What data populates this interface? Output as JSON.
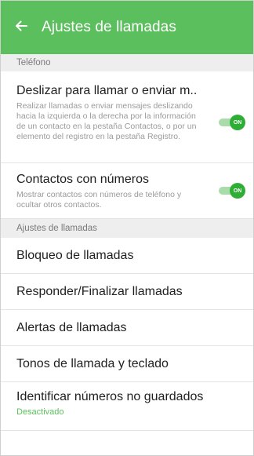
{
  "appbar": {
    "back_icon": "arrow-left-icon",
    "title": "Ajustes de llamadas",
    "color": "#5bbf5e"
  },
  "sections": {
    "phone_header": "Teléfono",
    "call_settings_header": "Ajustes de llamadas"
  },
  "swipe": {
    "title": "Deslizar para llamar o enviar m..",
    "description": "Realizar llamadas o enviar mensajes deslizando hacia la izquierda o la derecha por la información de un contacto en la pestaña Contactos, o por un elemento del registro en la pestaña Registro.",
    "toggle_label": "ON",
    "enabled": true
  },
  "contacts_numbers": {
    "title": "Contactos con números",
    "description": "Mostrar contactos con números de teléfono y ocultar otros contactos.",
    "toggle_label": "ON",
    "enabled": true
  },
  "items": {
    "call_blocking": "Bloqueo de llamadas",
    "answer_end": "Responder/Finalizar llamadas",
    "call_alerts": "Alertas de llamadas",
    "ringtones": "Tonos de llamada y teclado",
    "caller_id": "Identificar números no guardados",
    "caller_id_status": "Desactivado"
  },
  "colors": {
    "accent": "#5bbf5e",
    "toggle_on": "#2fae36"
  }
}
